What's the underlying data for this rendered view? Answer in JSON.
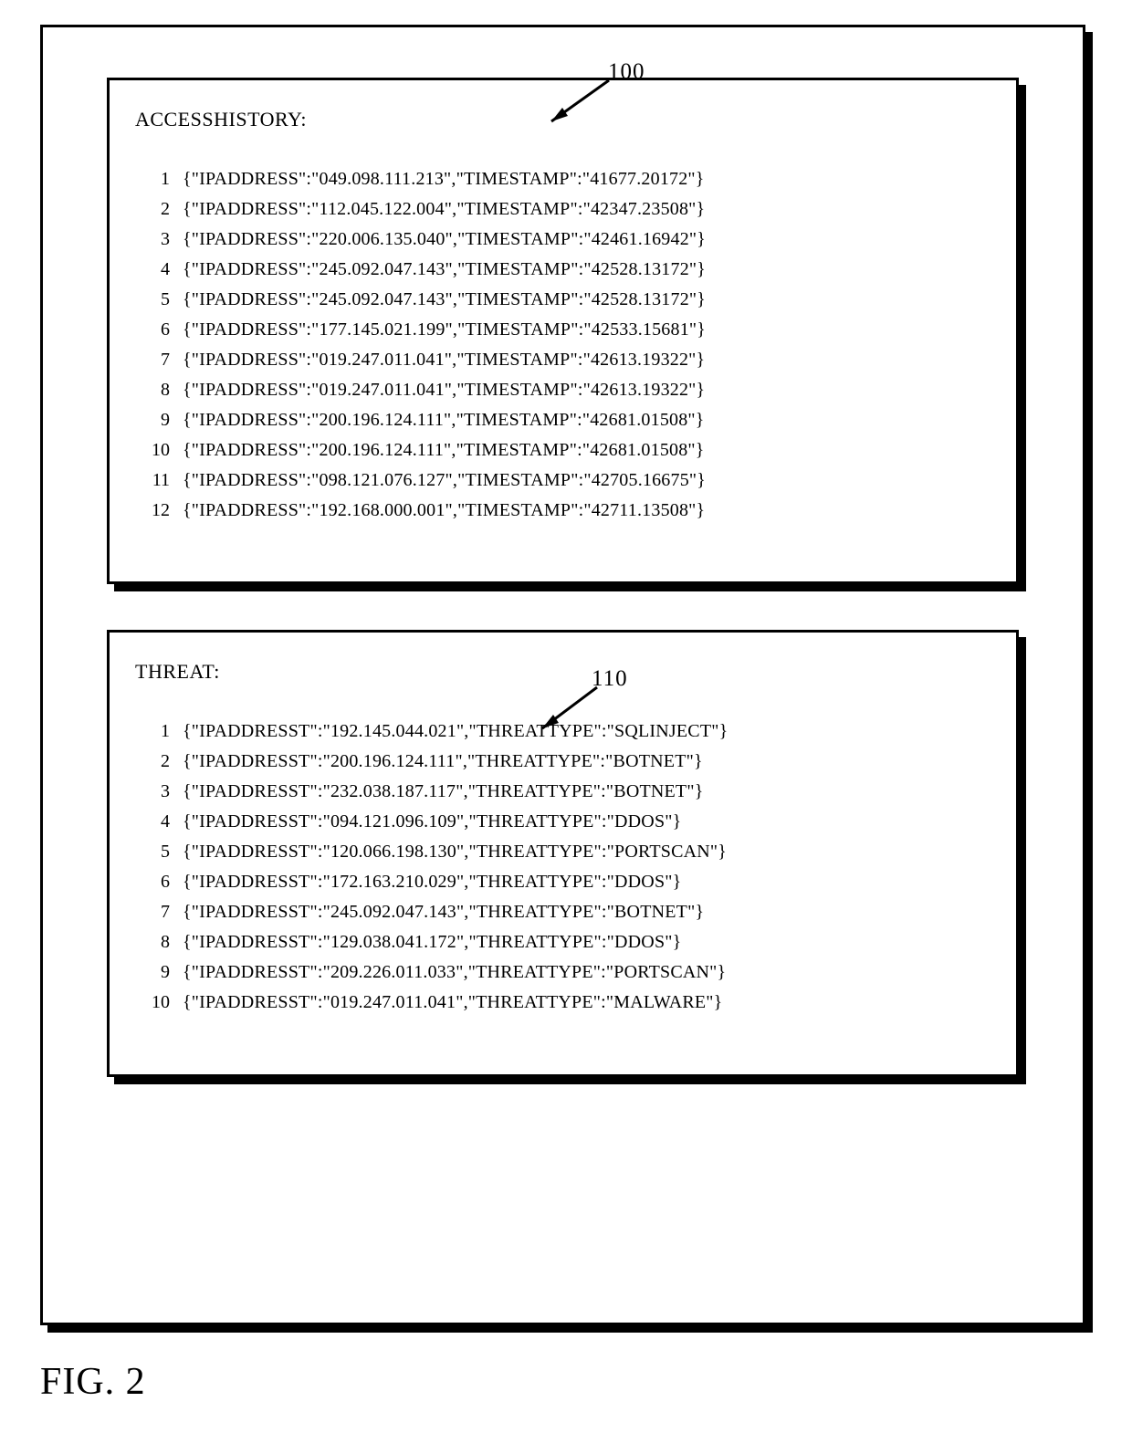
{
  "figure_label": "FIG. 2",
  "callouts": {
    "access_history": "100",
    "threat": "110"
  },
  "panels": {
    "access_history": {
      "title": "ACCESSHISTORY:",
      "rows": [
        {
          "n": "1",
          "text": "{\"IPADDRESS\":\"049.098.111.213\",\"TIMESTAMP\":\"41677.20172\"}"
        },
        {
          "n": "2",
          "text": "{\"IPADDRESS\":\"112.045.122.004\",\"TIMESTAMP\":\"42347.23508\"}"
        },
        {
          "n": "3",
          "text": "{\"IPADDRESS\":\"220.006.135.040\",\"TIMESTAMP\":\"42461.16942\"}"
        },
        {
          "n": "4",
          "text": "{\"IPADDRESS\":\"245.092.047.143\",\"TIMESTAMP\":\"42528.13172\"}"
        },
        {
          "n": "5",
          "text": "{\"IPADDRESS\":\"245.092.047.143\",\"TIMESTAMP\":\"42528.13172\"}"
        },
        {
          "n": "6",
          "text": "{\"IPADDRESS\":\"177.145.021.199\",\"TIMESTAMP\":\"42533.15681\"}"
        },
        {
          "n": "7",
          "text": "{\"IPADDRESS\":\"019.247.011.041\",\"TIMESTAMP\":\"42613.19322\"}"
        },
        {
          "n": "8",
          "text": "{\"IPADDRESS\":\"019.247.011.041\",\"TIMESTAMP\":\"42613.19322\"}"
        },
        {
          "n": "9",
          "text": "{\"IPADDRESS\":\"200.196.124.111\",\"TIMESTAMP\":\"42681.01508\"}"
        },
        {
          "n": "10",
          "text": "{\"IPADDRESS\":\"200.196.124.111\",\"TIMESTAMP\":\"42681.01508\"}"
        },
        {
          "n": "11",
          "text": "{\"IPADDRESS\":\"098.121.076.127\",\"TIMESTAMP\":\"42705.16675\"}"
        },
        {
          "n": "12",
          "text": "{\"IPADDRESS\":\"192.168.000.001\",\"TIMESTAMP\":\"42711.13508\"}"
        }
      ]
    },
    "threat": {
      "title": "THREAT:",
      "rows": [
        {
          "n": "1",
          "text": "{\"IPADDRESST\":\"192.145.044.021\",\"THREATTYPE\":\"SQLINJECT\"}"
        },
        {
          "n": "2",
          "text": "{\"IPADDRESST\":\"200.196.124.111\",\"THREATTYPE\":\"BOTNET\"}"
        },
        {
          "n": "3",
          "text": "{\"IPADDRESST\":\"232.038.187.117\",\"THREATTYPE\":\"BOTNET\"}"
        },
        {
          "n": "4",
          "text": "{\"IPADDRESST\":\"094.121.096.109\",\"THREATTYPE\":\"DDOS\"}"
        },
        {
          "n": "5",
          "text": "{\"IPADDRESST\":\"120.066.198.130\",\"THREATTYPE\":\"PORTSCAN\"}"
        },
        {
          "n": "6",
          "text": "{\"IPADDRESST\":\"172.163.210.029\",\"THREATTYPE\":\"DDOS\"}"
        },
        {
          "n": "7",
          "text": "{\"IPADDRESST\":\"245.092.047.143\",\"THREATTYPE\":\"BOTNET\"}"
        },
        {
          "n": "8",
          "text": "{\"IPADDRESST\":\"129.038.041.172\",\"THREATTYPE\":\"DDOS\"}"
        },
        {
          "n": "9",
          "text": "{\"IPADDRESST\":\"209.226.011.033\",\"THREATTYPE\":\"PORTSCAN\"}"
        },
        {
          "n": "10",
          "text": "{\"IPADDRESST\":\"019.247.011.041\",\"THREATTYPE\":\"MALWARE\"}"
        }
      ]
    }
  }
}
